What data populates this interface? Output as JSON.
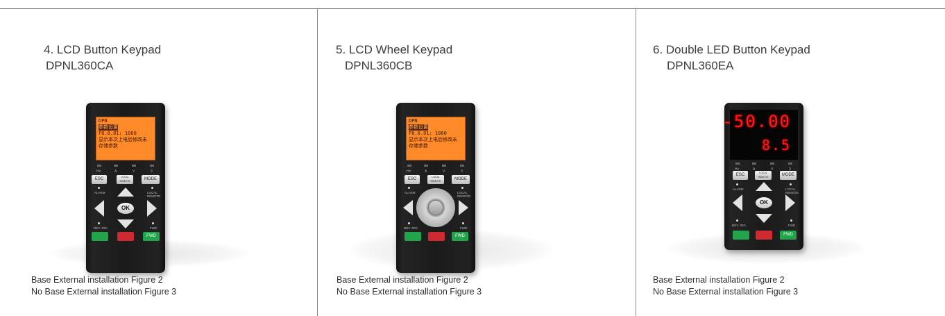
{
  "columns": [
    {
      "title": "4. LCD Button Keypad",
      "model": "DPNL360CA",
      "display": "lcd",
      "control": "buttons",
      "notes": [
        "Base External installation Figure 2",
        "No Base External installation Figure 3"
      ]
    },
    {
      "title": "5. LCD Wheel Keypad",
      "model": "DPNL360CB",
      "display": "lcd",
      "control": "wheel",
      "notes": [
        "Base External installation Figure 2",
        "No Base External installation Figure 3"
      ]
    },
    {
      "title": "6. Double LED Button Keypad",
      "model": "DPNL360EA",
      "display": "led",
      "control": "buttons",
      "notes": [
        "Base External installation Figure 2",
        "No Base External installation Figure 3"
      ]
    }
  ],
  "keypad": {
    "lcd_lines": [
      "DPN",
      "参数设置",
      "F0.0.01: 1000",
      "显示本次上电后修改未",
      "存储参数"
    ],
    "led_top": "-50.00",
    "led_bottom": "8.5",
    "indicators": [
      "Hz",
      "A",
      "V",
      "3"
    ],
    "esc": "ESC",
    "local_remote": "LOCAL REMOTE",
    "mode": "MODE",
    "alarm": "ALARM",
    "ok": "OK",
    "rev_jog": "REV JOG",
    "fwd_label": "FWD",
    "fwd_button": "FWD"
  },
  "colors": {
    "lcd_orange": "#ff8a2a",
    "led_red": "#ff1a1a",
    "run_green": "#22a44a",
    "stop_red": "#cf2a2f"
  }
}
